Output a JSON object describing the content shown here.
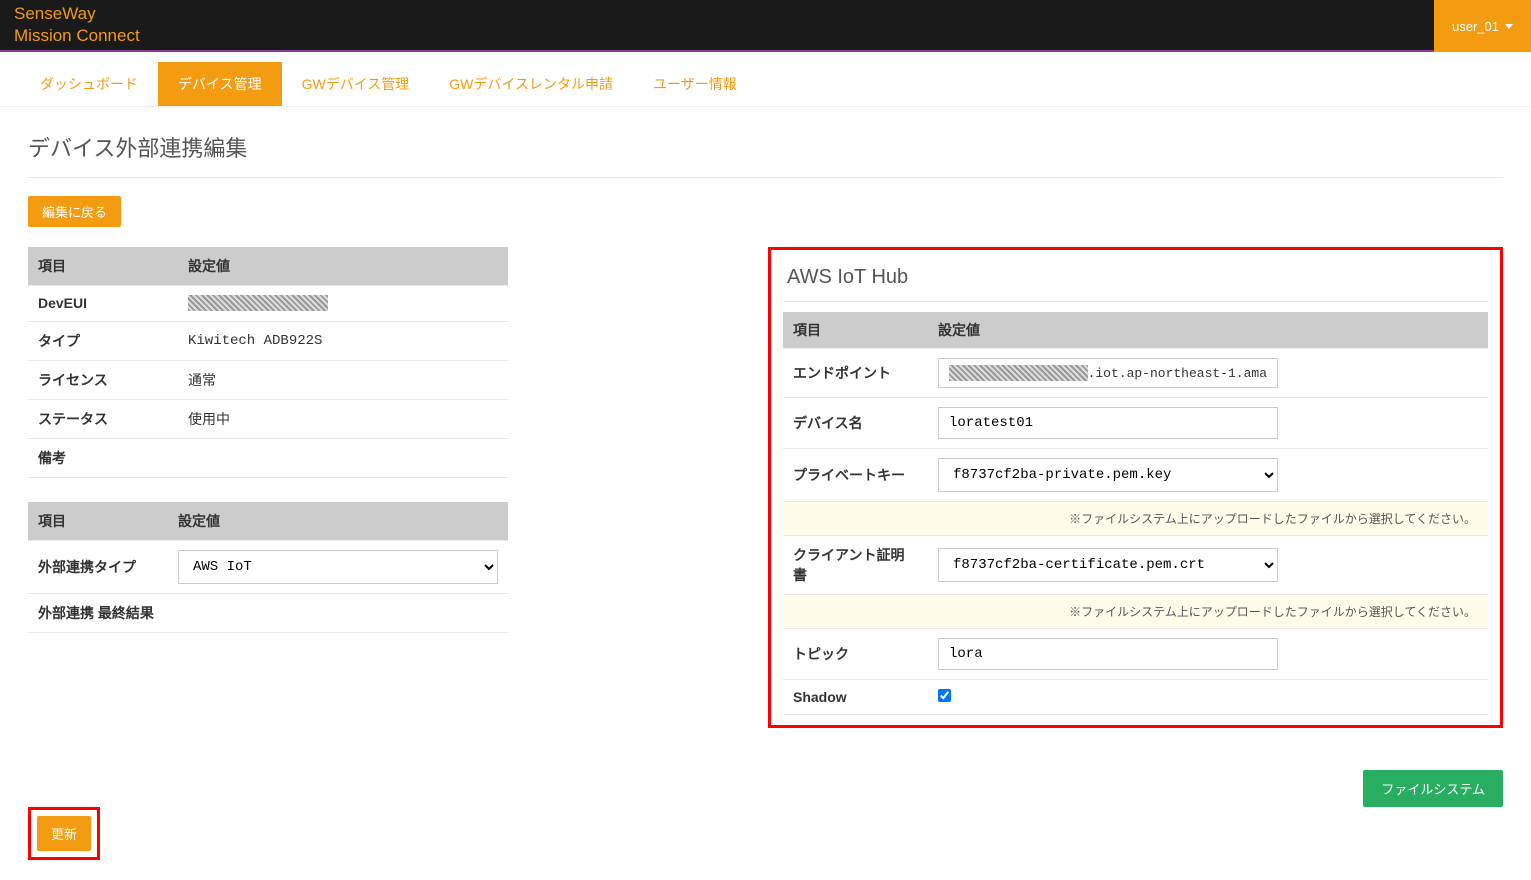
{
  "header": {
    "brand_line1": "SenseWay",
    "brand_line2": "Mission Connect",
    "user_label": "user_01"
  },
  "tabs": [
    {
      "label": "ダッシュボード",
      "active": false
    },
    {
      "label": "デバイス管理",
      "active": true
    },
    {
      "label": "GWデバイス管理",
      "active": false
    },
    {
      "label": "GWデバイスレンタル申請",
      "active": false
    },
    {
      "label": "ユーザー情報",
      "active": false
    }
  ],
  "page": {
    "title": "デバイス外部連携編集",
    "back_label": "編集に戻る",
    "update_label": "更新",
    "filesystem_label": "ファイルシステム"
  },
  "device_table": {
    "header_item": "項目",
    "header_value": "設定値",
    "rows": {
      "deveui_label": "DevEUI",
      "type_label": "タイプ",
      "type_value": "Kiwitech ADB922S",
      "license_label": "ライセンス",
      "license_value": "通常",
      "status_label": "ステータス",
      "status_value": "使用中",
      "notes_label": "備考",
      "notes_value": ""
    }
  },
  "link_table": {
    "header_item": "項目",
    "header_value": "設定値",
    "type_label": "外部連携タイプ",
    "type_selected": "AWS IoT",
    "type_options": [
      "AWS IoT"
    ],
    "result_label": "外部連携 最終結果",
    "result_value": ""
  },
  "aws_panel": {
    "title": "AWS IoT Hub",
    "header_item": "項目",
    "header_value": "設定値",
    "endpoint_label": "エンドポイント",
    "endpoint_suffix": ".iot.ap-northeast-1.ama",
    "device_name_label": "デバイス名",
    "device_name_value": "loratest01",
    "private_key_label": "プライベートキー",
    "private_key_value": "f8737cf2ba-private.pem.key",
    "private_key_options": [
      "f8737cf2ba-private.pem.key"
    ],
    "file_note": "※ファイルシステム上にアップロードしたファイルから選択してください。",
    "client_cert_label": "クライアント証明書",
    "client_cert_value": "f8737cf2ba-certificate.pem.crt",
    "client_cert_options": [
      "f8737cf2ba-certificate.pem.crt"
    ],
    "topic_label": "トピック",
    "topic_value": "lora",
    "shadow_label": "Shadow",
    "shadow_checked": true
  }
}
